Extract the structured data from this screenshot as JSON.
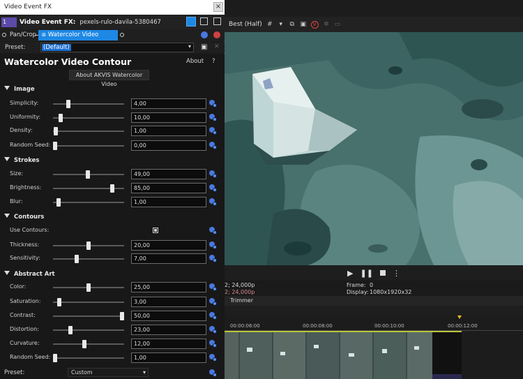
{
  "window": {
    "title": "Video Event FX",
    "close": "×"
  },
  "fx_header": {
    "label": "Video Event FX:",
    "clip_name": "pexels-rulo-davila-5380467"
  },
  "chain": {
    "items": [
      "Pan/Crop",
      "Watercolor Video Contour"
    ]
  },
  "preset": {
    "label": "Preset:",
    "value": "(Default)"
  },
  "plugin": {
    "title": "Watercolor Video Contour",
    "about_link": "About",
    "help": "?",
    "about_button": "About AKVIS Watercolor Video",
    "sections": {
      "image": "Image",
      "strokes": "Strokes",
      "contours": "Contours",
      "abstract": "Abstract Art"
    },
    "params": {
      "simplicity": {
        "label": "Simplicity:",
        "value": "4,00",
        "pos": 0.2
      },
      "uniformity": {
        "label": "Uniformity:",
        "value": "10,00",
        "pos": 0.08
      },
      "density": {
        "label": "Density:",
        "value": "1,00",
        "pos": 0.01
      },
      "random_seed": {
        "label": "Random Seed:",
        "value": "0,00",
        "pos": 0.0
      },
      "size": {
        "label": "Size:",
        "value": "49,00",
        "pos": 0.49
      },
      "brightness": {
        "label": "Brightness:",
        "value": "85,00",
        "pos": 0.85
      },
      "blur": {
        "label": "Blur:",
        "value": "1,00",
        "pos": 0.05
      },
      "use_contours": {
        "label": "Use Contours:"
      },
      "thickness": {
        "label": "Thickness:",
        "value": "20,00",
        "pos": 0.5
      },
      "sensitivity": {
        "label": "Sensitivity:",
        "value": "7,00",
        "pos": 0.32
      },
      "color": {
        "label": "Color:",
        "value": "25,00",
        "pos": 0.5
      },
      "saturation": {
        "label": "Saturation:",
        "value": "3,00",
        "pos": 0.06
      },
      "contrast": {
        "label": "Contrast:",
        "value": "50,00",
        "pos": 1.0
      },
      "distortion": {
        "label": "Distortion:",
        "value": "23,00",
        "pos": 0.23
      },
      "curvature": {
        "label": "Curvature:",
        "value": "12,00",
        "pos": 0.44
      },
      "random_seed2": {
        "label": "Random Seed:",
        "value": "1,00",
        "pos": 0.0
      }
    },
    "preset_bottom": {
      "label": "Preset:",
      "value": "Custom"
    }
  },
  "preview_toolbar": {
    "quality": "Best (Half)"
  },
  "info": {
    "line1": "2; 24,000p",
    "line2": "2; 24,000p",
    "frame_label": "Frame:",
    "frame_value": "0",
    "display_label": "Display:",
    "display_value": "1080x1920x32"
  },
  "trimmer": "Trimmer",
  "ruler": [
    "00:00:06:00",
    "00:00:08:00",
    "00:00:10:00",
    "00:00:12:00"
  ],
  "colors": {
    "accent": "#1e88e5",
    "keyframe": "#4a78e0",
    "clip_border": "#b8c63a"
  }
}
